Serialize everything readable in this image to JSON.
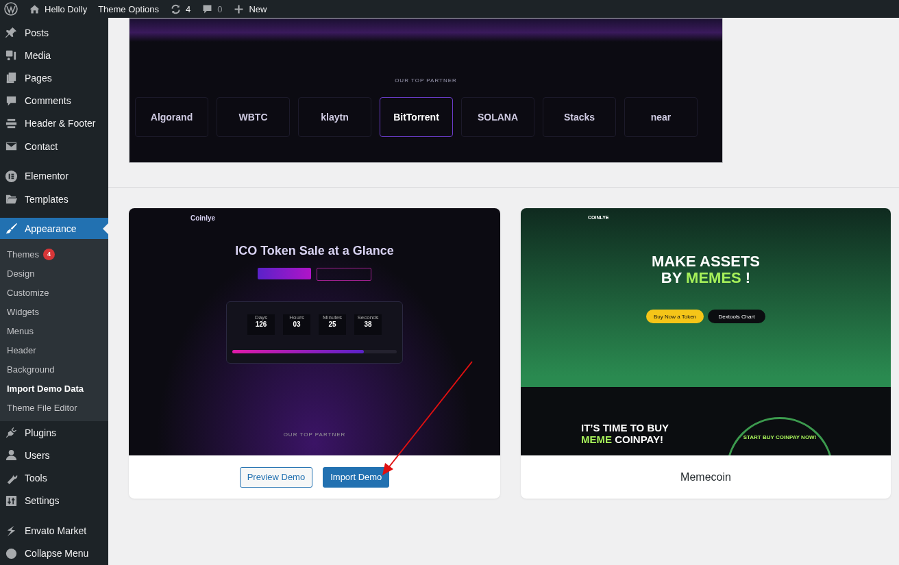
{
  "admin_bar": {
    "site_name": "Hello Dolly",
    "theme_options": "Theme Options",
    "updates_count": "4",
    "comments_count": "0",
    "new_label": "New"
  },
  "sidebar": {
    "groups": [
      {
        "items": [
          {
            "label": "Posts",
            "selected": false
          },
          {
            "label": "Media",
            "selected": false
          },
          {
            "label": "Pages",
            "selected": false
          },
          {
            "label": "Comments",
            "selected": false
          },
          {
            "label": "Header & Footer",
            "selected": false
          },
          {
            "label": "Contact",
            "selected": false
          }
        ]
      },
      {
        "items": [
          {
            "label": "Elementor",
            "selected": false
          },
          {
            "label": "Templates",
            "selected": false
          }
        ]
      },
      {
        "items": [
          {
            "label": "Appearance",
            "selected": true,
            "children": [
              {
                "label": "Themes",
                "badge": "4",
                "selected": false
              },
              {
                "label": "Design",
                "selected": false
              },
              {
                "label": "Customize",
                "selected": false
              },
              {
                "label": "Widgets",
                "selected": false
              },
              {
                "label": "Menus",
                "selected": false
              },
              {
                "label": "Header",
                "selected": false
              },
              {
                "label": "Background",
                "selected": false
              },
              {
                "label": "Import Demo Data",
                "selected": true
              },
              {
                "label": "Theme File Editor",
                "selected": false
              }
            ]
          },
          {
            "label": "Plugins",
            "selected": false
          },
          {
            "label": "Users",
            "selected": false
          },
          {
            "label": "Tools",
            "selected": false
          },
          {
            "label": "Settings",
            "selected": false
          }
        ]
      },
      {
        "items": [
          {
            "label": "Envato Market",
            "selected": false
          },
          {
            "label": "Collapse Menu",
            "selected": false
          }
        ]
      }
    ]
  },
  "top_preview": {
    "heading": "OUR TOP PARTNER",
    "partners": [
      {
        "name": "Algorand",
        "highlighted": false
      },
      {
        "name": "WBTC",
        "highlighted": false
      },
      {
        "name": "klaytn",
        "highlighted": false
      },
      {
        "name": "BitTorrent",
        "highlighted": true
      },
      {
        "name": "SOLANA",
        "highlighted": false
      },
      {
        "name": "Stacks",
        "highlighted": false
      },
      {
        "name": "near",
        "highlighted": false
      }
    ]
  },
  "demos": [
    {
      "kind": "ico",
      "logo": "Coinlye",
      "headline": "ICO Token Sale at a Glance",
      "countdown": [
        {
          "label": "Days",
          "value": "126"
        },
        {
          "label": "Hours",
          "value": "03"
        },
        {
          "label": "Minutes",
          "value": "25"
        },
        {
          "label": "Seconds",
          "value": "38"
        }
      ],
      "progress": {
        "level": 0.8
      },
      "partner_heading": "OUR TOP PARTNER",
      "buttons": [
        {
          "label": "Preview Demo",
          "kind": "outline"
        },
        {
          "label": "Import Demo",
          "kind": "primary"
        }
      ]
    },
    {
      "kind": "meme",
      "logo": "COINLYE",
      "headline_1": "MAKE ASSETS",
      "headline_2": "BY",
      "headline_3": "MEMES",
      "headline_4": "!",
      "cta_1": "Buy Now a Token",
      "cta_2": "Dextools Chart",
      "section_1": "IT’S TIME TO BUY",
      "section_2": "MEME",
      "section_3": "COINPAY!",
      "section_badge": "START BUY COINPAY NOW!",
      "title": "Memecoin"
    }
  ]
}
